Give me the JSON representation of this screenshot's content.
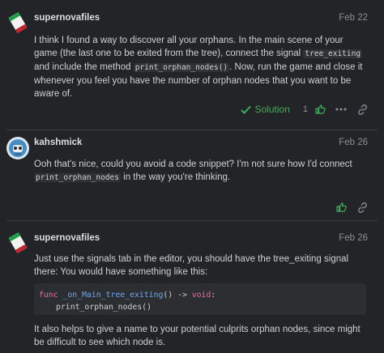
{
  "posts": [
    {
      "username": "supernovafiles",
      "date": "Feb 22",
      "body": {
        "p1_a": "I think I found a way to discover all your orphans. In the main scene of your game (the last one to be exited from the tree), connect the signal ",
        "code1": "tree_exiting",
        "p1_b": " and include the method ",
        "code2": "print_orphan_nodes()",
        "p1_c": ". Now, run the game and close it whenever you feel you have the number of orphan nodes that you want to be aware of."
      },
      "solution_label": "Solution",
      "like_count": "1"
    },
    {
      "username": "kahshmick",
      "date": "Feb 26",
      "body": {
        "p1_a": "Ooh that's nice, could you avoid a code snippet? I'm not sure how I'd connect ",
        "code1": "print_orphan_nodes",
        "p1_b": " in the way you're thinking."
      }
    },
    {
      "username": "supernovafiles",
      "date": "Feb 26",
      "body": {
        "p1": "Just use the signals tab in the editor, you should have the tree_exiting signal there: You would have something like this:",
        "code_line1_kw": "func",
        "code_line1_fn": "_on_Main_tree_exiting",
        "code_line1_mid": "() -> ",
        "code_line1_ret": "void",
        "code_line1_end": ":",
        "code_line2": "print_orphan_nodes()",
        "p2": "It also helps to give a name to your potential culprits orphan nodes, since might be difficult to see which node is."
      }
    }
  ],
  "colors": {
    "accent_green": "#3fae5c",
    "bg": "#232427"
  },
  "icons": [
    "check-icon",
    "heart-icon",
    "more-icon",
    "link-icon"
  ]
}
